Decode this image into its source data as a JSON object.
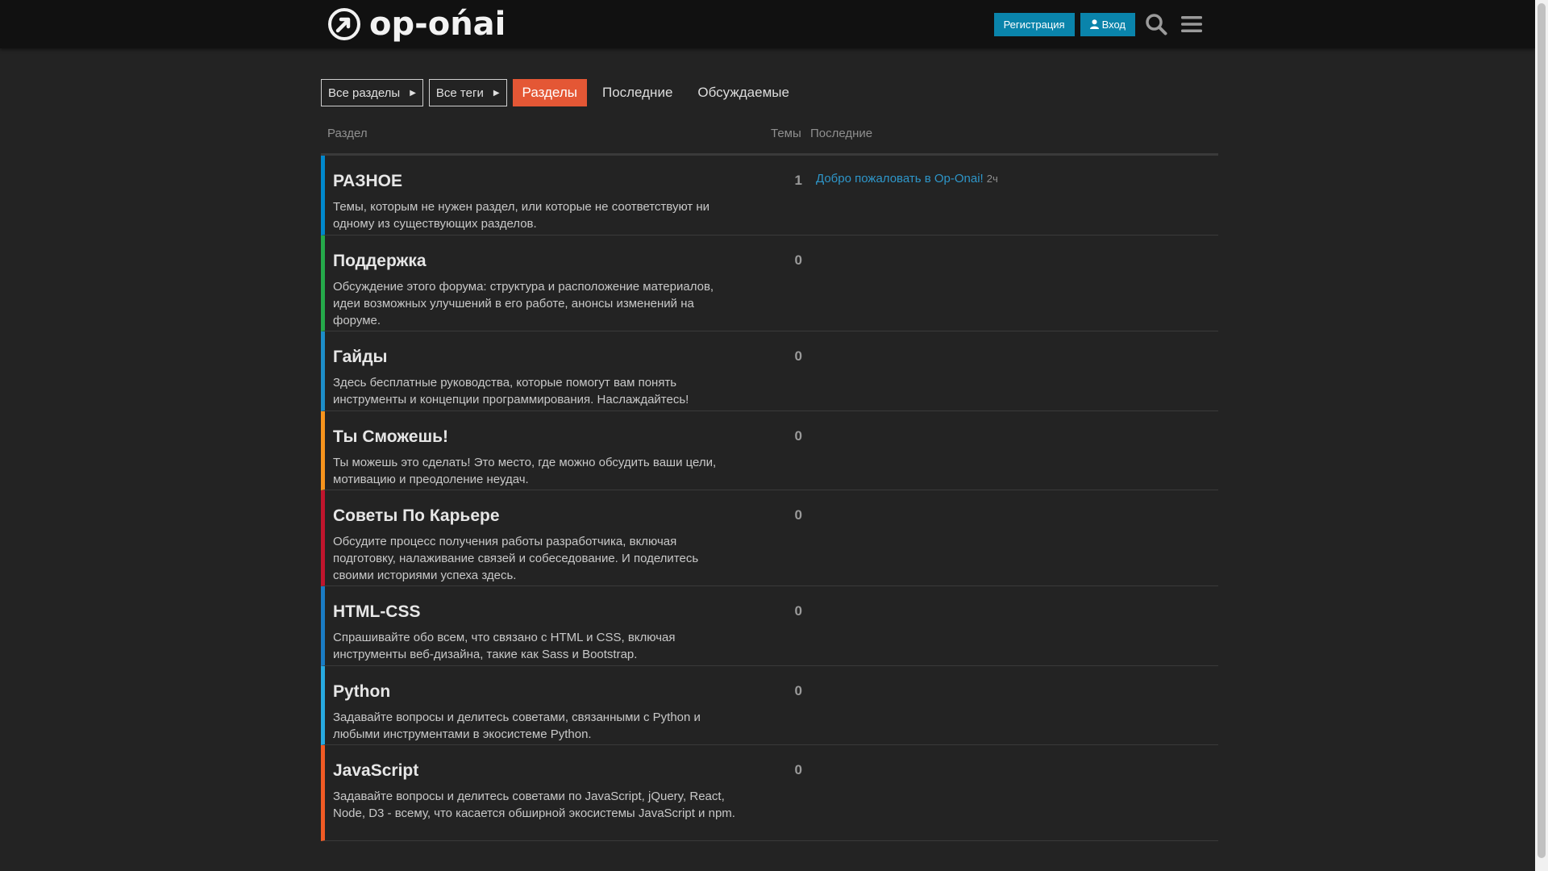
{
  "header": {
    "logo_text": "op-ońai",
    "register_label": "Регистрация",
    "login_label": "Вход",
    "search_icon": "search-icon",
    "menu_icon": "hamburger-menu-icon"
  },
  "nav": {
    "categories_dropdown": "Все разделы",
    "tags_dropdown": "Все теги",
    "tabs": [
      {
        "label": "Разделы",
        "active": true
      },
      {
        "label": "Последние",
        "active": false
      },
      {
        "label": "Обсуждаемые",
        "active": false
      }
    ]
  },
  "table": {
    "col_category": "Раздел",
    "col_topics": "Темы",
    "col_latest": "Последние",
    "rows": [
      {
        "name": "РАЗНОЕ",
        "desc": "Темы, которым не нужен раздел, или которые не соответствуют ни одному из существующих разделов.",
        "topics": "1",
        "color": "#0088cc",
        "latest_title": "Добро пожаловать в Op-Onai!",
        "latest_age": "2ч"
      },
      {
        "name": "Поддержка",
        "desc": "Обсуждение этого форума: структура и расположение материалов, идеи возможных улучшений в его работе, анонсы изменений на форуме.",
        "topics": "0",
        "color": "#25aa4a",
        "latest_title": "",
        "latest_age": ""
      },
      {
        "name": "Гайды",
        "desc": "Здесь бесплатные руководства, которые помогут вам понять инструменты и концепции программирования. Наслаждайтесь!",
        "topics": "0",
        "color": "#1d8ec9",
        "latest_title": "",
        "latest_age": ""
      },
      {
        "name": "Ты Сможешь!",
        "desc": "Ты можешь это сделать! Это место, где можно обсудить ваши цели, мотивацию и преодоление неудач.",
        "topics": "0",
        "color": "#f7941d",
        "latest_title": "",
        "latest_age": ""
      },
      {
        "name": "Советы По Карьере",
        "desc": "Обсудите процесс получения работы разработчика, включая подготовку, налаживание связей и собеседование. И поделитесь своими историями успеха здесь.",
        "topics": "0",
        "color": "#c0152d",
        "latest_title": "",
        "latest_age": ""
      },
      {
        "name": "HTML-CSS",
        "desc": "Спрашивайте обо всем, что связано с HTML и CSS, включая инструменты веб-дизайна, такие как Sass и Bootstrap.",
        "topics": "0",
        "color": "#1a7cc4",
        "latest_title": "",
        "latest_age": ""
      },
      {
        "name": "Python",
        "desc": "Задавайте вопросы и делитесь советами, связанными с Python и любыми инструментами в экосистеме Python.",
        "topics": "0",
        "color": "#27aae1",
        "latest_title": "",
        "latest_age": ""
      },
      {
        "name": "JavaScript",
        "desc": "Задавайте вопросы и делитесь советами по JavaScript, jQuery, React, Node, D3 - всему, что касается обширной экосистемы JavaScript и npm.",
        "topics": "0",
        "color": "#f15a24",
        "latest_title": "",
        "latest_age": ""
      }
    ]
  },
  "colors": {
    "accent": "#e45735",
    "primary_button": "#0a84ab",
    "link": "#2e96c9",
    "background": "#232323",
    "header_bg": "#111111"
  }
}
